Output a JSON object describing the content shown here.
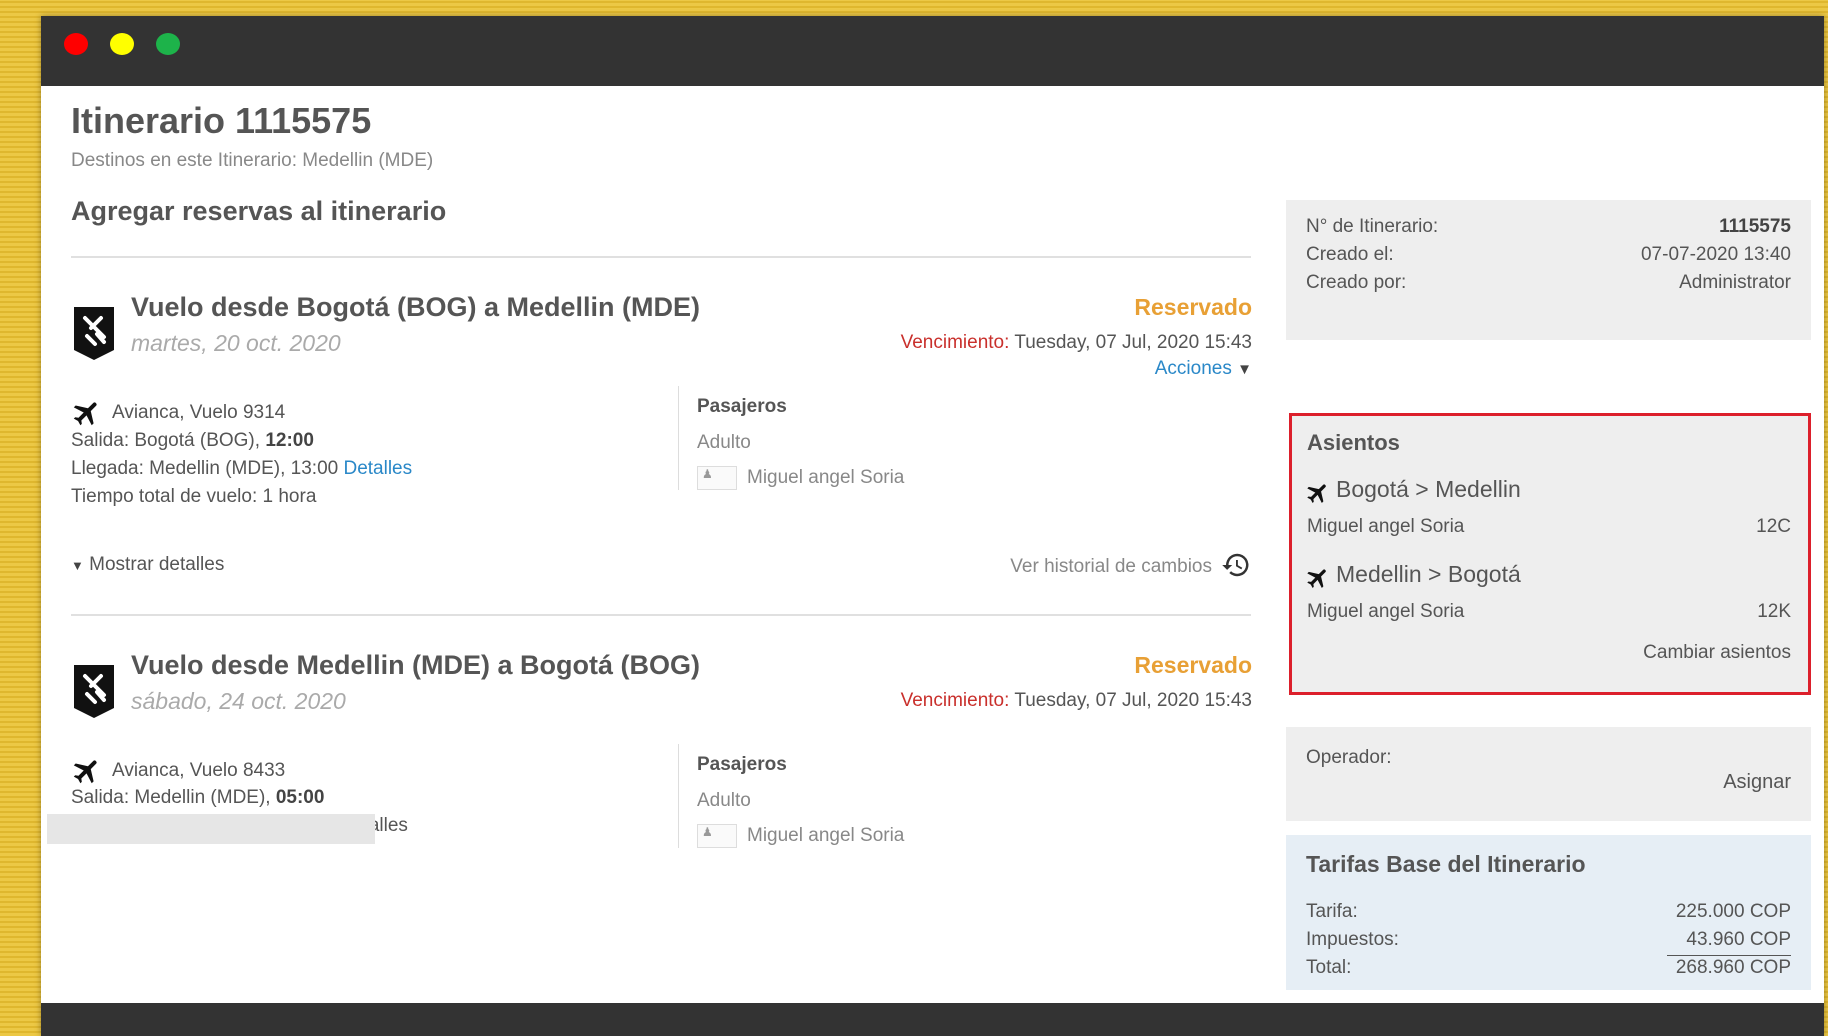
{
  "header": {
    "title": "Itinerario 1115575",
    "destinations": "Destinos en este Itinerario: Medellin (MDE)",
    "section_title": "Agregar reservas al itinerario"
  },
  "flights": [
    {
      "title": "Vuelo desde Bogotá (BOG) a Medellin (MDE)",
      "date": "martes, 20 oct. 2020",
      "status": "Reservado",
      "expiry_label": "Vencimiento:",
      "expiry_value": " Tuesday, 07 Jul, 2020 15:43",
      "actions_label": "Acciones",
      "airline": "Avianca, Vuelo 9314",
      "departure_label": "Salida: Bogotá (BOG), ",
      "departure_time": "12:00",
      "arrival_text": "Llegada: Medellin (MDE), 13:00 ",
      "details_link": "Detalles",
      "duration": "Tiempo total de vuelo: 1 hora",
      "passengers_title": "Pasajeros",
      "passenger_type": "Adulto",
      "passenger_name": "Miguel angel Soria",
      "show_details": "Mostrar detalles",
      "history_link": "Ver historial de cambios"
    },
    {
      "title": "Vuelo desde Medellin (MDE) a Bogotá (BOG)",
      "date": "sábado, 24 oct. 2020",
      "status": "Reservado",
      "expiry_label": "Vencimiento:",
      "expiry_value": " Tuesday, 07 Jul, 2020 15:43",
      "airline": "Avianca, Vuelo 8433",
      "departure_label": "Salida: Medellin (MDE), ",
      "departure_time": "05:00",
      "details_link": "etalles",
      "passengers_title": "Pasajeros",
      "passenger_type": "Adulto",
      "passenger_name": "Miguel angel Soria"
    }
  ],
  "summary": {
    "itinerary_label": "N° de Itinerario:",
    "itinerary_value": "1115575",
    "created_label": "Creado el:",
    "created_value": "07-07-2020 13:40",
    "created_by_label": "Creado por:",
    "created_by_value": "Administrator"
  },
  "seats": {
    "title": "Asientos",
    "routes": [
      {
        "route": "Bogotá > Medellin",
        "passenger": "Miguel angel Soria",
        "seat": "12C"
      },
      {
        "route": "Medellin > Bogotá",
        "passenger": "Miguel angel Soria",
        "seat": "12K"
      }
    ],
    "change_link": "Cambiar asientos"
  },
  "operator": {
    "label": "Operador:",
    "assign_link": "Asignar"
  },
  "fares": {
    "title": "Tarifas Base del Itinerario",
    "rows": [
      {
        "label": "Tarifa:",
        "value": "225.000 COP"
      },
      {
        "label": "Impuestos:",
        "value": "43.960 COP"
      },
      {
        "label": "Total:",
        "value": "268.960 COP"
      }
    ]
  },
  "colors": {
    "status": "#e8a035",
    "link": "#2a88c8",
    "expiry_label": "#c9302c",
    "highlight_border": "#dc1f2b",
    "titlebar": "#333333"
  }
}
